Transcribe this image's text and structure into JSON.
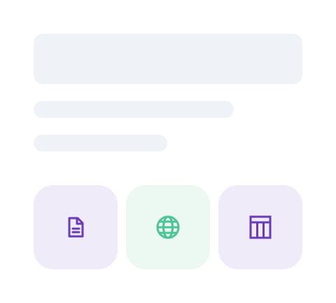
{
  "colors": {
    "skeleton": "#eff2f7",
    "document_tile_bg": "#f0ebf8",
    "document_icon": "#6a3bb8",
    "web_tile_bg": "#ecf8f2",
    "web_icon": "#4cc497",
    "table_tile_bg": "#f0ebf8",
    "table_icon": "#6a3bb8"
  },
  "tiles": [
    {
      "icon": "document-icon"
    },
    {
      "icon": "globe-icon"
    },
    {
      "icon": "table-icon"
    }
  ]
}
